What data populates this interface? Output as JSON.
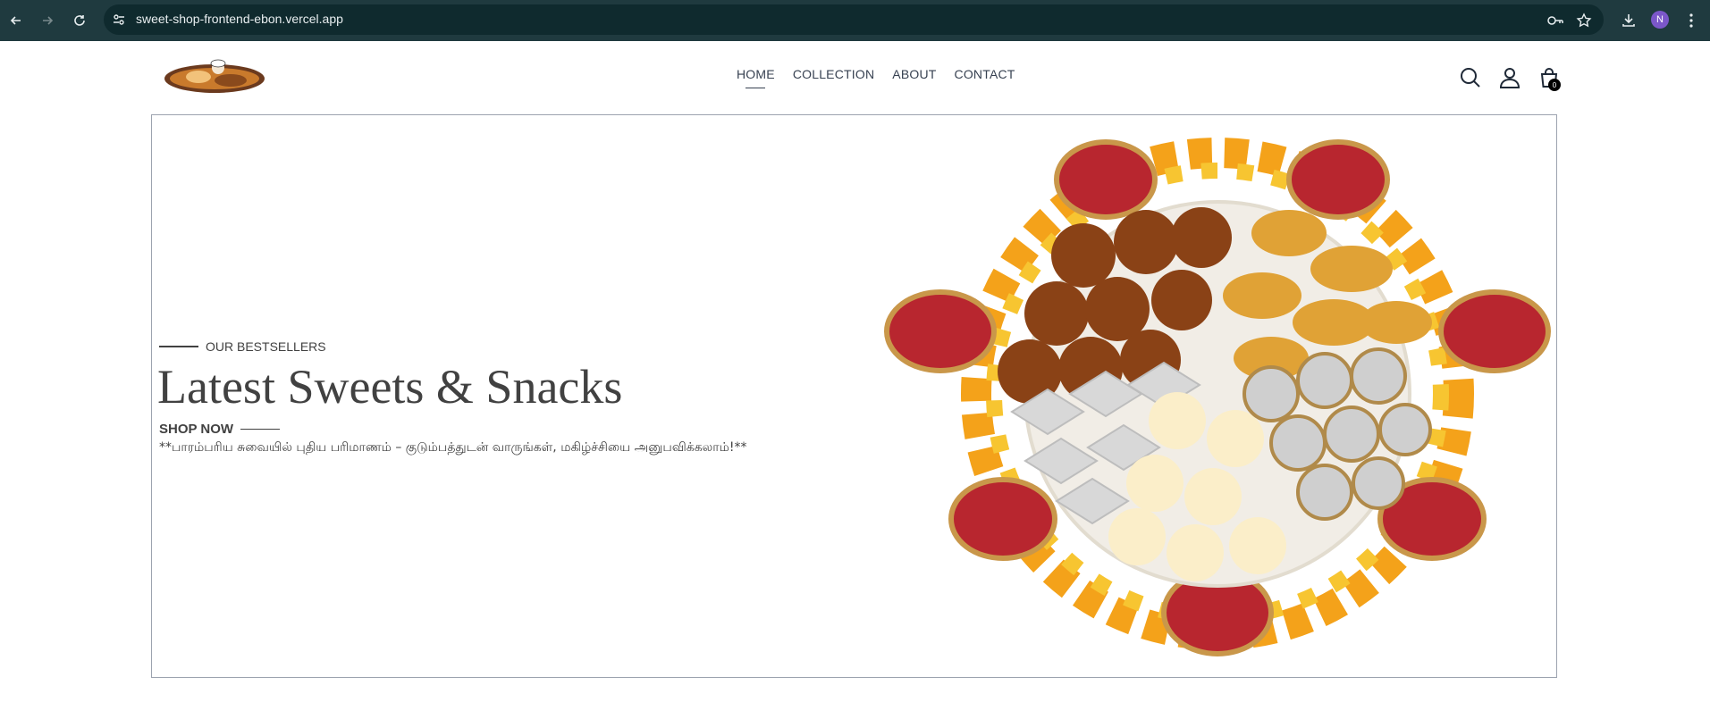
{
  "browser": {
    "url": "sweet-shop-frontend-ebon.vercel.app",
    "profile_initial": "N"
  },
  "nav": {
    "items": [
      {
        "label": "HOME",
        "active": true
      },
      {
        "label": "COLLECTION",
        "active": false
      },
      {
        "label": "ABOUT",
        "active": false
      },
      {
        "label": "CONTACT",
        "active": false
      }
    ]
  },
  "cart": {
    "count": "0"
  },
  "hero": {
    "eyebrow": "OUR BESTSELLERS",
    "title": "Latest Sweets & Snacks",
    "cta": "SHOP NOW",
    "tagline": "**பாரம்பரிய சுவையில் புதிய பரிமாணம் – குடும்பத்துடன் வாருங்கள், மகிழ்ச்சியை அனுபவிக்கலாம்!**"
  },
  "colors": {
    "chrome_bg": "#1f3a3f",
    "text": "#414141",
    "border": "#9ca3af"
  }
}
